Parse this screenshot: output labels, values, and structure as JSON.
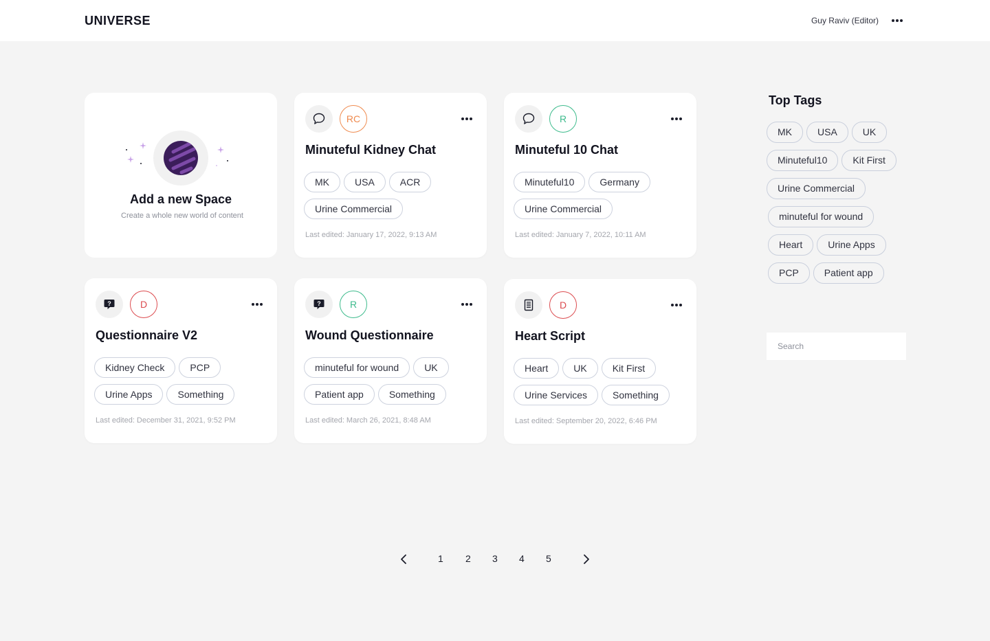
{
  "header": {
    "logo": "UNIVERSE",
    "user": "Guy Raviv (Editor)",
    "menu_icon": "more-horizontal-icon"
  },
  "new_space": {
    "title": "Add a new Space",
    "subtitle": "Create a whole new world of content",
    "icon": "planet-icon"
  },
  "cards": [
    {
      "type_icon": "chat-bubble-icon",
      "avatar": "RC",
      "avatar_color": "#ef8a4e",
      "title": "Minuteful Kidney Chat",
      "tags": [
        "MK",
        "USA",
        "ACR",
        "Urine Commercial"
      ],
      "edited": "Last edited: January 17, 2022, 9:13 AM"
    },
    {
      "type_icon": "chat-bubble-icon",
      "avatar": "R",
      "avatar_color": "#3dbb8c",
      "title": "Minuteful 10 Chat",
      "tags": [
        "Minuteful10",
        "Germany",
        "Urine Commercial"
      ],
      "edited": "Last edited: January 7, 2022, 10:11 AM"
    },
    {
      "type_icon": "question-bubble-icon",
      "avatar": "D",
      "avatar_color": "#dc4b4f",
      "title": "Questionnaire V2",
      "tags": [
        "Kidney Check",
        "PCP",
        "Urine Apps",
        "Something"
      ],
      "edited": "Last edited: December 31, 2021, 9:52 PM"
    },
    {
      "type_icon": "question-bubble-icon",
      "avatar": "R",
      "avatar_color": "#3dbb8c",
      "title": "Wound Questionnaire",
      "tags": [
        "minuteful for wound",
        "UK",
        "Patient app",
        "Something"
      ],
      "edited": "Last edited: March 26, 2021, 8:48 AM"
    },
    {
      "type_icon": "document-icon",
      "avatar": "D",
      "avatar_color": "#dc4b4f",
      "title": "Heart Script",
      "tags": [
        "Heart",
        "UK",
        "Kit First",
        "Urine Services",
        "Something"
      ],
      "edited": "Last edited: September 20, 2022, 6:46 PM"
    }
  ],
  "sidebar": {
    "title": "Top Tags",
    "tags": [
      "MK",
      "USA",
      "UK",
      "Minuteful10",
      "Kit First",
      "Urine Commercial",
      "minuteful for wound",
      "Heart",
      "Urine Apps",
      "PCP",
      "Patient app"
    ],
    "search_placeholder": "Search"
  },
  "pagination": {
    "pages": [
      "1",
      "2",
      "3",
      "4",
      "5"
    ],
    "prev_icon": "chevron-left-icon",
    "next_icon": "chevron-right-icon"
  }
}
